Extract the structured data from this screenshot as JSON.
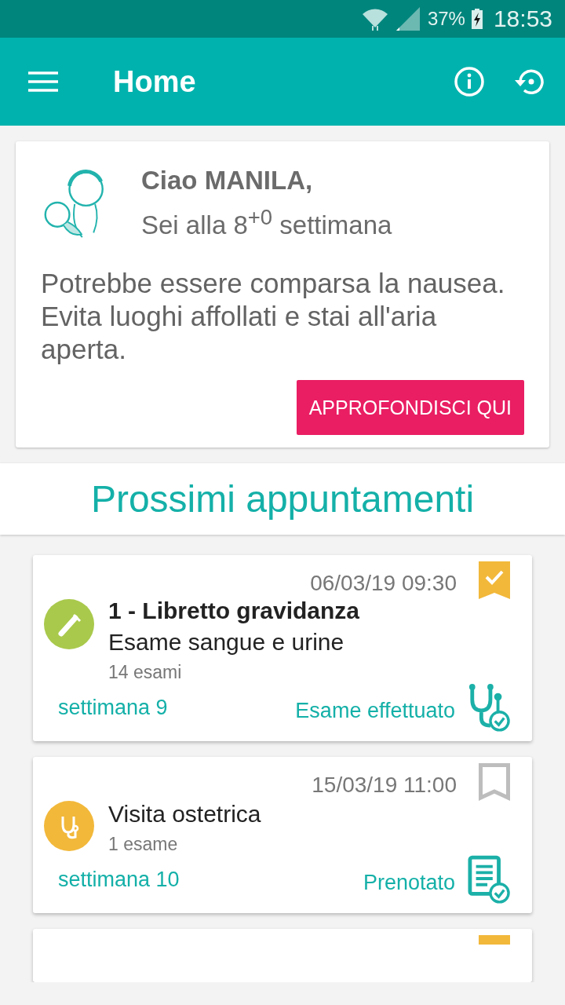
{
  "status_bar": {
    "battery": "37%",
    "time": "18:53"
  },
  "app_bar": {
    "title": "Home"
  },
  "greeting": {
    "name_line": "Ciao MANILA,",
    "week_line": "Sei alla 8$^{+0}$ settimana",
    "message": "Potrebbe essere comparsa la nausea. Evita luoghi affollati e stai all'aria aperta.",
    "button": "APPROFONDISCI QUI"
  },
  "section_title": "Prossimi appuntamenti",
  "appointments": [
    {
      "date": "06/03/19 09:30",
      "bookmarked": true,
      "kind": "exam",
      "done": true,
      "color": "#a9c94c",
      "heading": "1 - Libretto gravidanza",
      "title": "Esame sangue e urine",
      "count": "14 esami",
      "week": "settimana 9",
      "status": "Esame effettuato"
    },
    {
      "date": "15/03/19 11:00",
      "bookmarked": false,
      "kind": "visit",
      "done": false,
      "color": "#f2b83a",
      "title": "Visita ostetrica",
      "count": "1 esame",
      "week": "settimana 10",
      "status": "Prenotato"
    }
  ],
  "partial_card": {
    "bookmarked": true
  }
}
